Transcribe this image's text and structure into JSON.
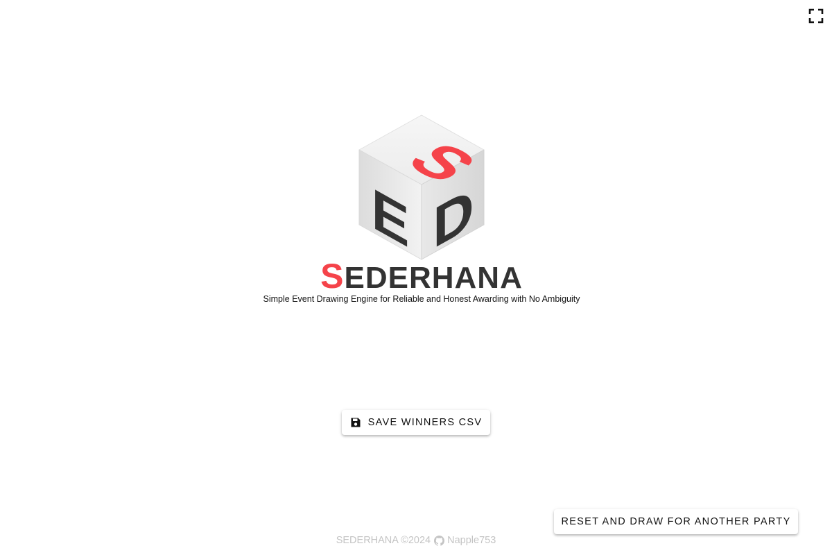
{
  "header": {
    "fullscreen_icon": "fullscreen-icon"
  },
  "logo": {
    "cube_icon": "dice-cube-logo",
    "cube_letters": {
      "top": "S",
      "left": "E",
      "right": "D"
    },
    "wordmark_first": "S",
    "wordmark_rest": "EDERHANA",
    "tagline": "Simple Event Drawing Engine for Reliable and Honest Awarding with No Ambiguity"
  },
  "actions": {
    "save_label": "SAVE WINNERS CSV",
    "save_icon": "floppy-disk-icon",
    "reset_label": "RESET AND DRAW FOR ANOTHER PARTY"
  },
  "footer": {
    "copyright": "SEDERHANA ©2024",
    "github_icon": "github-icon",
    "author": "Napple753"
  },
  "colors": {
    "accent": "#f5434a",
    "dark": "#333333",
    "cube_face": "#ececec",
    "footer_text": "#c4c4c4"
  }
}
